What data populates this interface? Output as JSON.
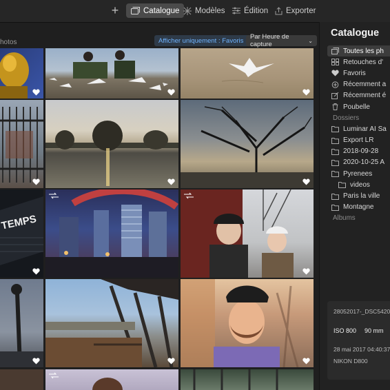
{
  "toolbar": {
    "add_symbol": "+",
    "tabs": [
      {
        "label": "Catalogue",
        "icon": "catalog-icon",
        "active": true
      },
      {
        "label": "Modèles",
        "icon": "templates-icon",
        "active": false
      },
      {
        "label": "Édition",
        "icon": "sliders-icon",
        "active": false
      },
      {
        "label": "Exporter",
        "icon": "export-icon",
        "active": false
      }
    ]
  },
  "grid_header": {
    "label": "hotos",
    "filter_label": "Afficher uniquement : Favoris",
    "sort_label": "Par Heure de capture"
  },
  "photos": [
    {
      "subject": "golden statue",
      "favorite": true,
      "stacked": false
    },
    {
      "subject": "people on bench with seagulls",
      "favorite": true,
      "stacked": false
    },
    {
      "subject": "seagull on sand",
      "favorite": true,
      "stacked": false
    },
    {
      "subject": "fence with padlocks",
      "favorite": true,
      "stacked": false
    },
    {
      "subject": "pond at sunset",
      "favorite": true,
      "stacked": false
    },
    {
      "subject": "bare tree silhouette",
      "favorite": true,
      "stacked": false
    },
    {
      "subject": "building facade TEMPS",
      "favorite": true,
      "stacked": false
    },
    {
      "subject": "city towers at dusk",
      "favorite": true,
      "stacked": true
    },
    {
      "subject": "two women portrait",
      "favorite": true,
      "stacked": true
    },
    {
      "subject": "street lamp",
      "favorite": true,
      "stacked": false
    },
    {
      "subject": "bridge over river",
      "favorite": true,
      "stacked": false
    },
    {
      "subject": "bearded man portrait",
      "favorite": true,
      "stacked": false
    },
    {
      "subject": "portrait partial",
      "favorite": false,
      "stacked": false
    },
    {
      "subject": "woman partial",
      "favorite": false,
      "stacked": true
    },
    {
      "subject": "structure partial",
      "favorite": false,
      "stacked": false
    }
  ],
  "panel": {
    "title": "Catalogue",
    "library": [
      {
        "label": "Toutes les ph",
        "icon": "photos-icon",
        "selected": true
      },
      {
        "label": "Retouches d'",
        "icon": "grid-icon",
        "selected": false
      },
      {
        "label": "Favoris",
        "icon": "heart-icon",
        "selected": false
      },
      {
        "label": "Récemment a",
        "icon": "plus-circle-icon",
        "selected": false
      },
      {
        "label": "Récemment é",
        "icon": "edit-icon",
        "selected": false
      },
      {
        "label": "Poubelle",
        "icon": "trash-icon",
        "selected": false
      }
    ],
    "folders_title": "Dossiers",
    "folders": [
      {
        "label": "Luminar AI Sa",
        "sub": false
      },
      {
        "label": "Export LR",
        "sub": false
      },
      {
        "label": "2018-09-28",
        "sub": false
      },
      {
        "label": "2020-10-25 A",
        "sub": false
      },
      {
        "label": "Pyrenees",
        "sub": false
      },
      {
        "label": "videos",
        "sub": true
      },
      {
        "label": "Paris la ville",
        "sub": false
      },
      {
        "label": "Montagne",
        "sub": false
      }
    ],
    "albums_title": "Albums"
  },
  "info": {
    "filename": "28052017-_DSC5420",
    "iso": "ISO 800",
    "focal": "90 mm",
    "date": "28 mai 2017 04:40:37",
    "camera": "NIKON D800"
  }
}
